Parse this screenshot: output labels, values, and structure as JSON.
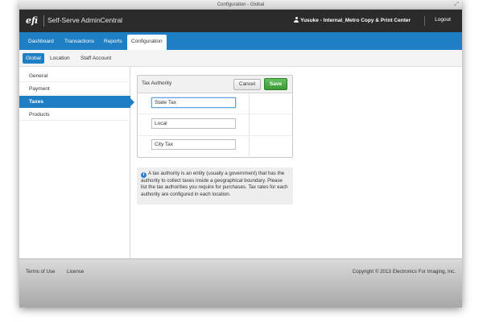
{
  "window": {
    "title": "Configuration - Global"
  },
  "header": {
    "logo": "efi",
    "app_name": "Self-Serve AdminCentral",
    "user": "Yusuke - Internal_Metro Copy & Print Center",
    "logout": "Logout"
  },
  "main_nav": {
    "tabs": [
      {
        "label": "Dashboard"
      },
      {
        "label": "Transactions"
      },
      {
        "label": "Reports"
      },
      {
        "label": "Configuration",
        "active": true
      }
    ]
  },
  "sub_nav": {
    "items": [
      {
        "label": "Global",
        "active": true
      },
      {
        "label": "Location"
      },
      {
        "label": "Staff Account"
      }
    ]
  },
  "sidebar": {
    "items": [
      {
        "label": "General"
      },
      {
        "label": "Payment"
      },
      {
        "label": "Taxes",
        "active": true
      },
      {
        "label": "Products"
      }
    ]
  },
  "panel": {
    "title": "Tax Authority",
    "cancel_label": "Cancel",
    "save_label": "Save",
    "authorities": [
      {
        "value": "State Tax"
      },
      {
        "value": "Local"
      },
      {
        "value": "City Tax"
      }
    ]
  },
  "info": {
    "text": "A tax authority is an entity (usually a government) that has the authority to collect taxes inside a geographical boundary. Please list the tax authorities you require for purchases. Tax rates for each authority are configured in each location."
  },
  "footer": {
    "terms": "Terms of Use",
    "license": "License",
    "copyright": "Copyright © 2013 Electronics For Imaging, Inc."
  },
  "colors": {
    "accent": "#1f7fc4",
    "header_bg": "#2b2b2b",
    "save_green": "#4aa944"
  },
  "icons": [
    "user-icon",
    "info-icon",
    "resize-icon"
  ]
}
